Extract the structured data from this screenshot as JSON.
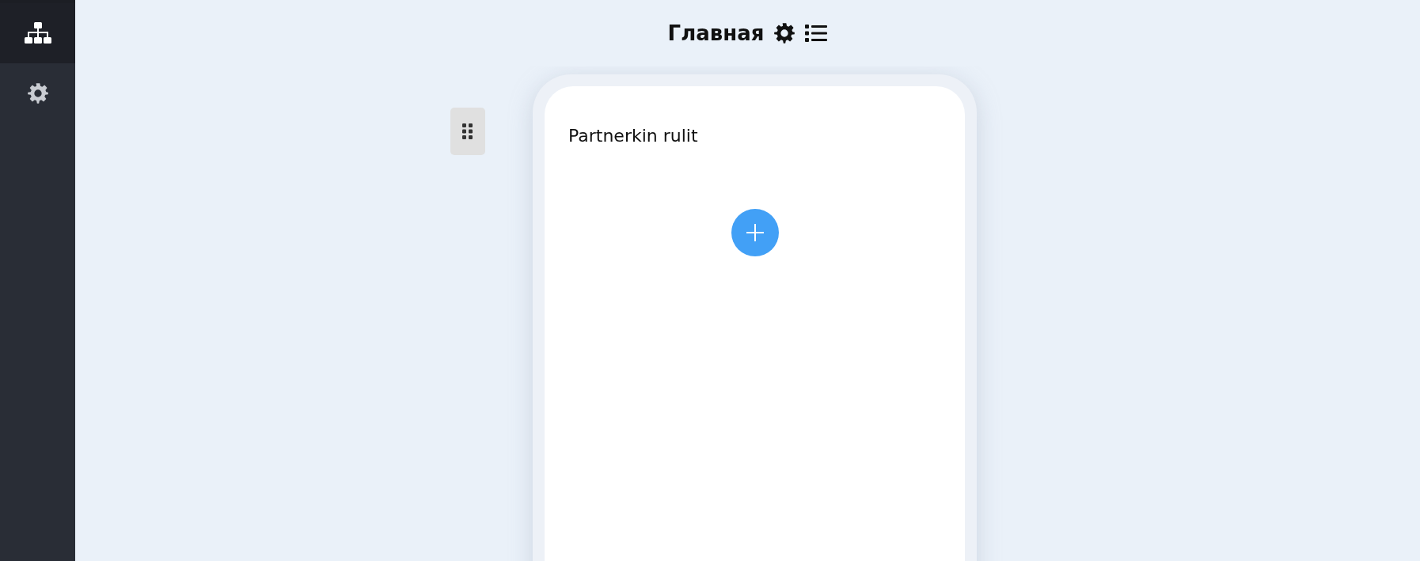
{
  "sidebar": {
    "items": [
      {
        "kind": "sitemap",
        "selected": true
      },
      {
        "kind": "settings",
        "selected": false
      }
    ]
  },
  "header": {
    "title": "Главная"
  },
  "page": {
    "blocks": [
      {
        "kind": "text",
        "text": "Partnerkin rulit"
      },
      {
        "kind": "add"
      }
    ]
  }
}
